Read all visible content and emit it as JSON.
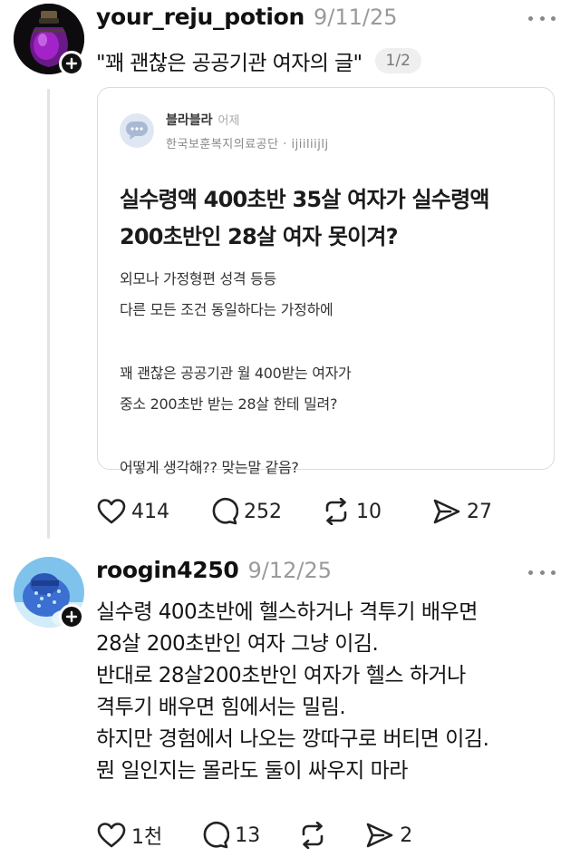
{
  "post": {
    "username": "your_reju_potion",
    "time": "9/11/25",
    "quote_title": "\"꽤 괜찮은 공공기관 여자의 글\"",
    "pager": "1/2",
    "card": {
      "author": "블라블라",
      "time": "어제",
      "org": "한국보훈복지의료공단 · ijiiliijlj",
      "headline": [
        "실수령액 400초반 35살 여자가 실수령액",
        "200초반인 28살 여자 못이겨?"
      ],
      "body": [
        "외모나 가정형편 성격 등등",
        "다른 모든 조건 동일하다는 가정하에",
        "",
        "꽤 괜찮은 공공기관 월 400받는 여자가",
        "중소 200초반 받는 28살 한테 밀려?",
        "",
        "어떻게 생각해?? 맞는말 같음?"
      ]
    },
    "actions": {
      "likes": "414",
      "comments": "252",
      "reposts": "10",
      "shares": "27"
    }
  },
  "reply": {
    "username": "roogin4250",
    "time": "9/12/25",
    "lines": [
      "실수령 400초반에 헬스하거나 격투기 배우면",
      "28살 200초반인 여자 그냥 이김.",
      "반대로 28살200초반인 여자가 헬스 하거나",
      "격투기 배우면 힘에서는 밀림.",
      "하지만  경험에서 나오는 깡따구로 버티면 이김.",
      "뭔 일인지는 몰라도 둘이 싸우지 마라"
    ],
    "actions": {
      "likes": "1천",
      "comments": "13",
      "reposts": "",
      "shares": "2"
    }
  },
  "icons": {
    "heart": "heart-icon",
    "comment": "comment-icon",
    "repost": "repost-icon",
    "share": "share-icon",
    "more": "more-icon",
    "follow": "follow-plus-icon"
  },
  "colors": {
    "background": "#ffffff",
    "text": "#111111",
    "muted": "#9a9a9a",
    "thread_line": "#e3e3e3"
  }
}
